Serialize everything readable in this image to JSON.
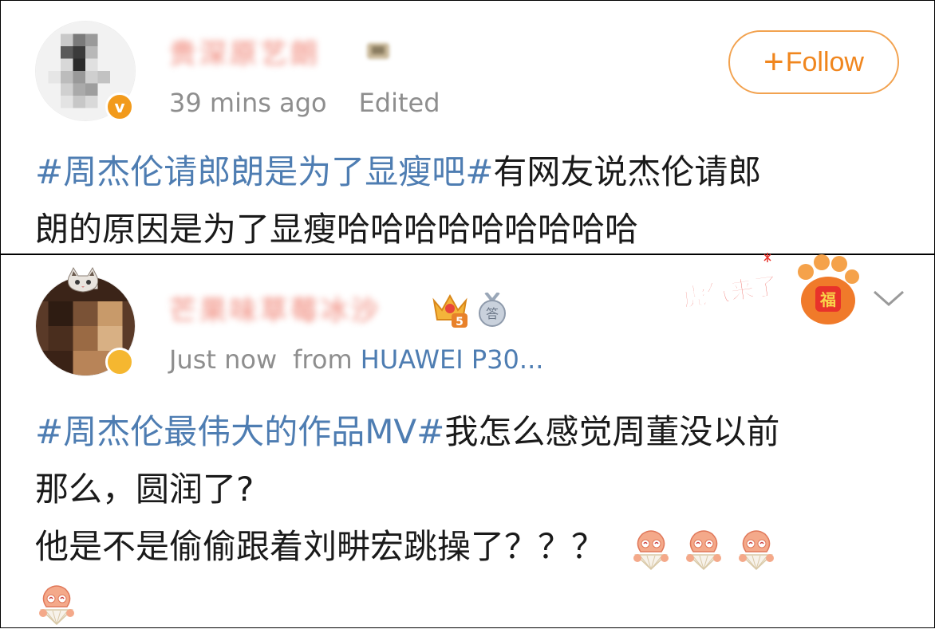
{
  "posts": [
    {
      "username": "贵深原艺朗",
      "timestamp": "39 mins ago",
      "edited_label": "Edited",
      "follow_label": "Follow",
      "hashtag": "#周杰伦请郎朗是为了显瘦吧#",
      "text_line1": "有网友说杰伦请郎",
      "text_line2": "朗的原因是为了显瘦哈哈哈哈哈哈哈哈哈",
      "avatar_icon": "avatar",
      "verified_icon": "verified-v-icon"
    },
    {
      "username": "芒果味草莓冰沙",
      "timestamp": "Just now",
      "source_prefix": "from",
      "source": "HUAWEI P30...",
      "hashtag": "#周杰伦最伟大的作品MV#",
      "text_line1": "我怎么感觉周董没以前",
      "text_line2": "那么，圆润了?",
      "text_line3": "他是不是偷偷跟着刘畊宏跳操了？？？",
      "emoji_count": 4,
      "emoji_icon": "laughing-fan-emoji-icon",
      "banner_text": "虎气来了",
      "banner_badge_text": "福",
      "medal_text": "答",
      "crown_level": "5"
    }
  ],
  "colors": {
    "hashtag": "#4e7db2",
    "follow_orange": "#f0861e",
    "meta_gray": "#8e8e8e"
  }
}
